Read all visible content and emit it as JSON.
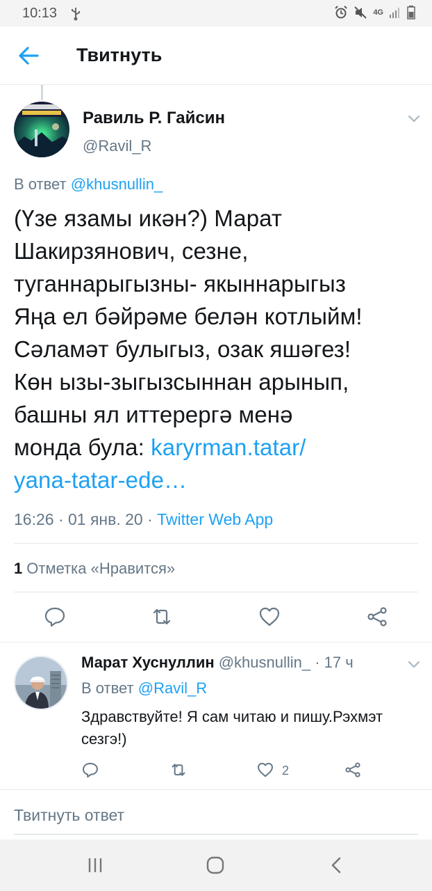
{
  "status_bar": {
    "time": "10:13",
    "network": "4G",
    "icons": [
      "usb-icon",
      "alarm-icon",
      "mute-icon",
      "signal-icon",
      "battery-icon"
    ]
  },
  "header": {
    "title": "Твитнуть",
    "back_icon": "arrow-left-icon"
  },
  "tweet": {
    "author_name": "Равиль Р. Гайсин",
    "author_handle": "@Ravil_R",
    "reply_to_label": "В ответ",
    "reply_to_handle": "@khusnullin_",
    "text_lines": [
      "(Үзе язамы икән?) Марат",
      "Шакирзянович, сезне,",
      "туганнарыгызны- якыннарыгыз",
      "Яңа ел бәйрәме белән котлыйм!",
      "Сәламәт булыгыз, озак яшәгез!",
      "Көн ызы-зыгызсыннан арынып,",
      "башны ял иттерергә менә"
    ],
    "text_last_prefix": "монда була: ",
    "link_part1": "karyrman.tatar/",
    "link_part2": "yana-tatar-ede…",
    "timestamp": "16:26 · 01 янв. 20 · ",
    "source": "Twitter Web App",
    "like_count": "1",
    "like_label": "Отметка «Нравится»",
    "actions": [
      "reply-icon",
      "retweet-icon",
      "like-icon",
      "share-icon"
    ]
  },
  "reply": {
    "author_name": "Марат Хуснуллин",
    "author_handle": "@khusnullin_ · 17 ч",
    "reply_to_label": "В ответ",
    "reply_to_handle": "@Ravil_R",
    "text": "Здравствуйте! Я сам читаю и пишу.Рэхмэт сезгэ!)",
    "like_count": "2"
  },
  "compose": {
    "placeholder": "Твитнуть ответ"
  },
  "navbar": {
    "buttons": [
      "recent-apps-icon",
      "home-icon",
      "back-icon"
    ]
  },
  "colors": {
    "accent": "#1da1f2",
    "secondary_text": "#657786",
    "primary_text": "#14171a",
    "divider": "#e1e8ed"
  }
}
